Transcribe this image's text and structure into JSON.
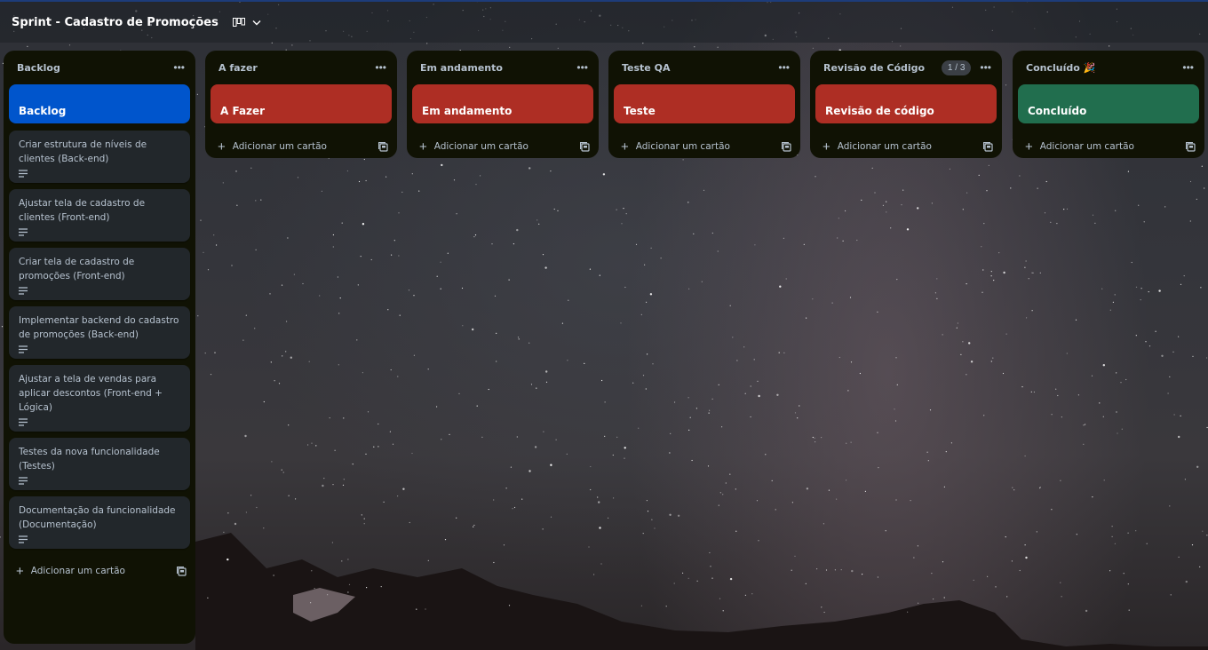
{
  "board": {
    "title": "Sprint - Cadastro de Promoções",
    "view_icon": "board-view-icon"
  },
  "colors": {
    "list_bg": "#101204",
    "card_bg": "#22272b",
    "text": "#b6c2cf",
    "blue": "#0055cc",
    "red": "#ae2e24",
    "green": "#216e4e"
  },
  "lists": [
    {
      "title": "Backlog",
      "cover": {
        "title": "Backlog",
        "color": "#0055cc"
      },
      "cards": [
        {
          "text": "Criar estrutura de níveis de clientes (Back-end)"
        },
        {
          "text": "Ajustar tela de cadastro de clientes (Front-end)"
        },
        {
          "text": "Criar tela de cadastro de promoções (Front-end)"
        },
        {
          "text": "Implementar backend do cadastro de promoções (Back-end)"
        },
        {
          "text": "Ajustar a tela de vendas para aplicar descontos (Front-end + Lógica)"
        },
        {
          "text": "Testes da nova funcionalidade (Testes)"
        },
        {
          "text": "Documentação da funcionalidade (Documentação)"
        }
      ],
      "add_label": "Adicionar um cartão"
    },
    {
      "title": "A fazer",
      "cover": {
        "title": "A Fazer",
        "color": "#ae2e24"
      },
      "cards": [],
      "add_label": "Adicionar um cartão"
    },
    {
      "title": "Em andamento",
      "cover": {
        "title": "Em andamento",
        "color": "#ae2e24"
      },
      "cards": [],
      "add_label": "Adicionar um cartão"
    },
    {
      "title": "Teste QA",
      "cover": {
        "title": "Teste",
        "color": "#ae2e24"
      },
      "cards": [],
      "add_label": "Adicionar um cartão"
    },
    {
      "title": "Revisão de Código",
      "counter": "1 / 3",
      "cover": {
        "title": "Revisão de código",
        "color": "#ae2e24"
      },
      "cards": [],
      "add_label": "Adicionar um cartão"
    },
    {
      "title": "Concluído 🎉",
      "cover": {
        "title": "Concluído",
        "color": "#216e4e"
      },
      "cards": [],
      "add_label": "Adicionar um cartão"
    }
  ]
}
